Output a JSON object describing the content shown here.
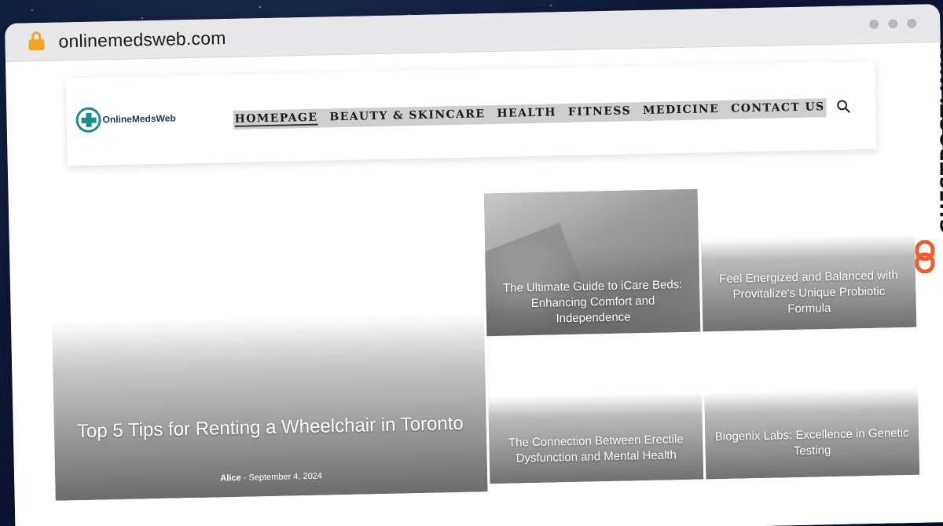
{
  "browser": {
    "url": "onlinemedsweb.com"
  },
  "site": {
    "logo_text": "OnlineMedsWeb",
    "nav": [
      {
        "label": "HOMEPAGE",
        "active": true
      },
      {
        "label": "BEAUTY & SKINCARE"
      },
      {
        "label": "HEALTH"
      },
      {
        "label": "FITNESS"
      },
      {
        "label": "MEDICINE"
      },
      {
        "label": "CONTACT US"
      }
    ]
  },
  "featured": {
    "title": "Top 5 Tips for Renting a Wheelchair in Toronto",
    "author": "Alice",
    "separator": "-",
    "date": "September 4, 2024"
  },
  "articles": [
    {
      "title": "The Ultimate Guide to iCare Beds: Enhancing Comfort and Independence"
    },
    {
      "title": "Feel Energized and Balanced with Provitalize's Unique Probiotic Formula"
    },
    {
      "title": "The Connection Between Erectile Dysfunction and Mental Health"
    },
    {
      "title": "Biogenix Labs: Excellence in Genetic Testing"
    }
  ],
  "watermark": {
    "text": "GUESTPOSTLINKS",
    "accent_color": "#f05a28"
  },
  "colors": {
    "lock": "#f2a51f",
    "logo": "#1a8d85"
  },
  "icons": [
    "lock-icon",
    "search-icon",
    "chain-link-icon",
    "logo-cross-icon"
  ]
}
